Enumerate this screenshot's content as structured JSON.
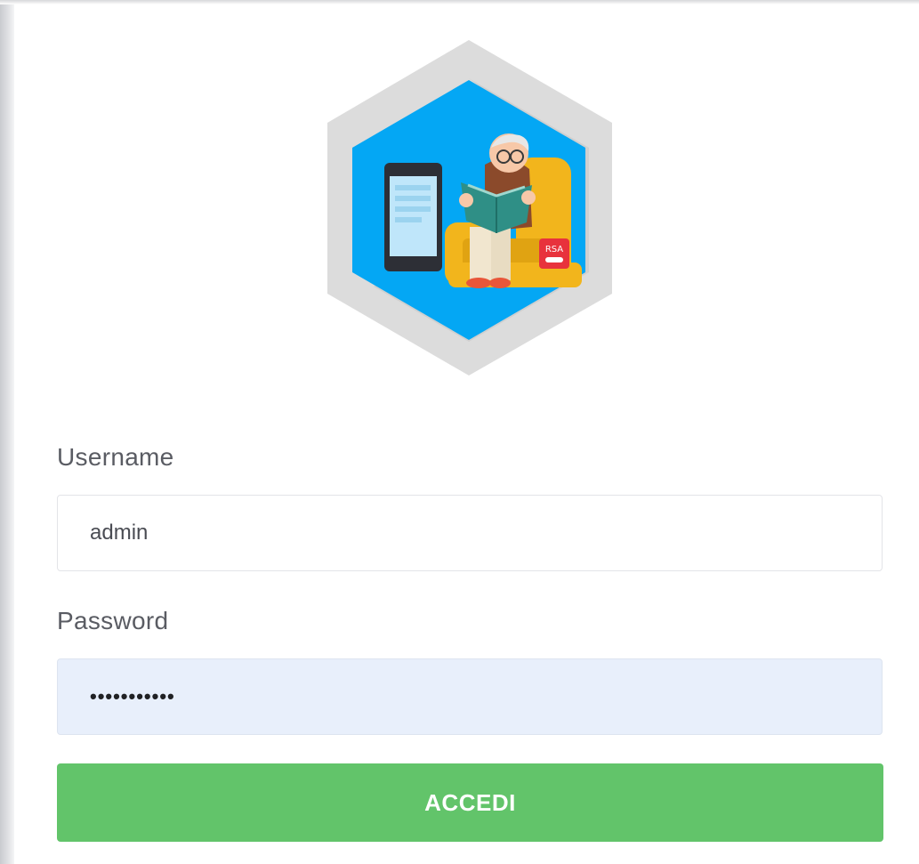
{
  "logo": {
    "icon": "elderly-man-reading-icon",
    "badge_text": "RSA",
    "colors": {
      "hexagon_outer": "#dcdcdc",
      "hexagon_inner": "#04a7f4",
      "armchair": "#f2b51c"
    }
  },
  "form": {
    "username_label": "Username",
    "username_value": "admin",
    "password_label": "Password",
    "password_value": "•••••••••••",
    "submit_label": "ACCEDI"
  },
  "colors": {
    "button": "#62c46a",
    "password_bg": "#e8effb",
    "label": "#5a5c63"
  }
}
